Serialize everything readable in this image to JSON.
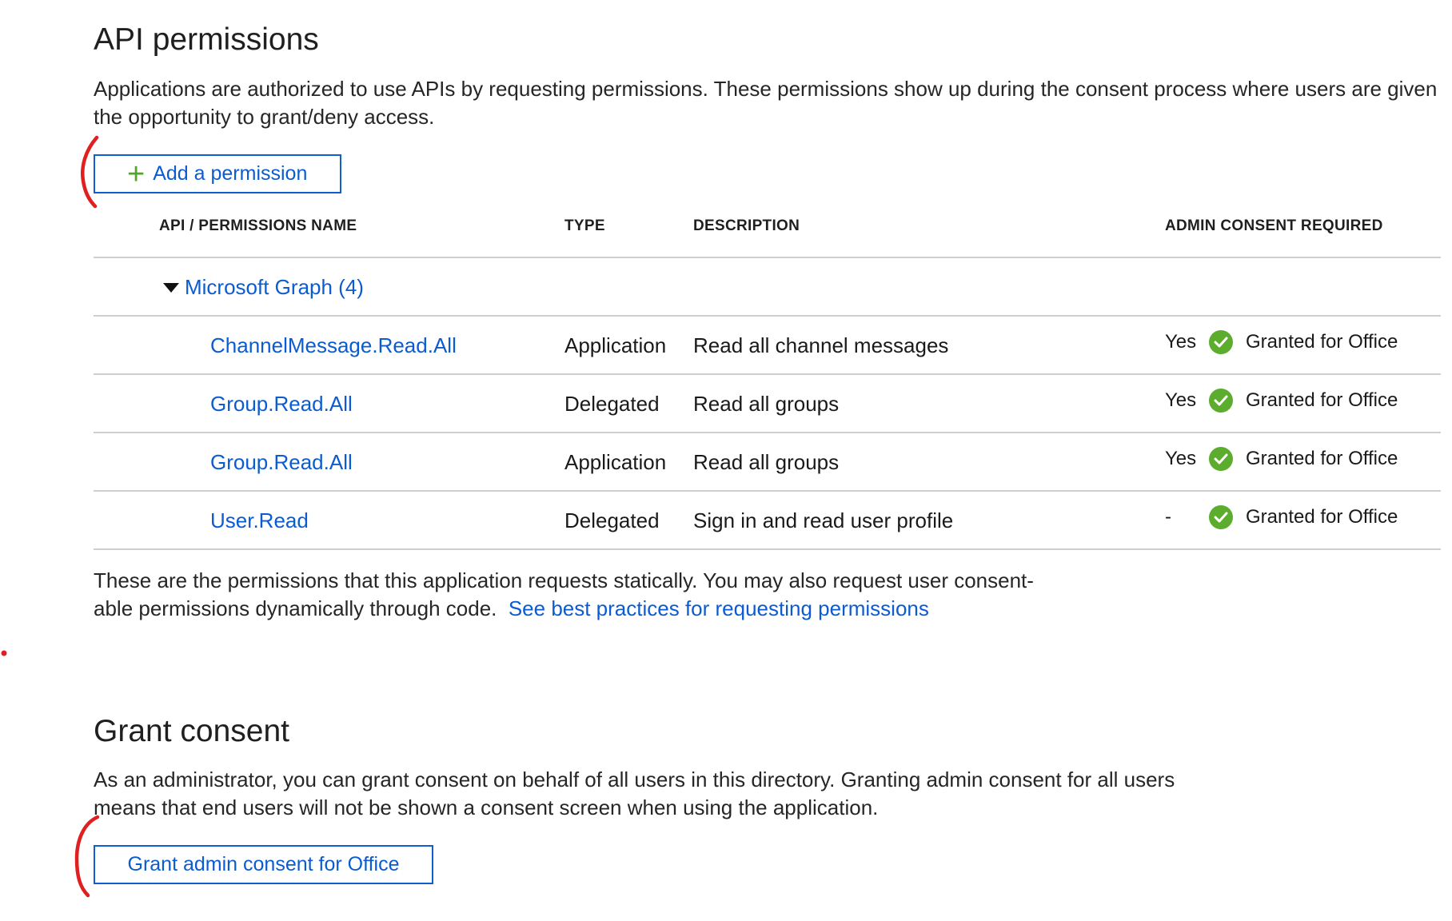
{
  "page": {
    "title": "API permissions",
    "intro_line1": "Applications are authorized to use APIs by requesting permissions. These permissions show up during the consent process where users are given",
    "intro_line2": "the opportunity to grant/deny access."
  },
  "toolbar": {
    "add_permission_label": "Add a permission",
    "add_icon": "plus-icon"
  },
  "table": {
    "headers": {
      "name": "API / PERMISSIONS NAME",
      "type": "TYPE",
      "description": "DESCRIPTION",
      "admin_consent": "ADMIN CONSENT REQUIRED"
    },
    "group": {
      "label": "Microsoft Graph (4)",
      "icon": "caret-down-icon"
    },
    "rows": [
      {
        "name": "ChannelMessage.Read.All",
        "type": "Application",
        "description": "Read all channel messages",
        "admin": "Yes",
        "status": "Granted for Office"
      },
      {
        "name": "Group.Read.All",
        "type": "Delegated",
        "description": "Read all groups",
        "admin": "Yes",
        "status": "Granted for Office"
      },
      {
        "name": "Group.Read.All",
        "type": "Application",
        "description": "Read all groups",
        "admin": "Yes",
        "status": "Granted for Office"
      },
      {
        "name": "User.Read",
        "type": "Delegated",
        "description": "Sign in and read user profile",
        "admin": "-",
        "status": "Granted for Office"
      }
    ]
  },
  "footer": {
    "line1": "These are the permissions that this application requests statically. You may also request user consent-",
    "line2_prefix": "able permissions dynamically through code.",
    "link": "See best practices for requesting permissions"
  },
  "grant": {
    "title": "Grant consent",
    "line1": "As an administrator, you can grant consent on behalf of all users in this directory. Granting admin consent for all users",
    "line2": "means that end users will not be shown a consent screen when using the application.",
    "button_label": "Grant admin consent for Office"
  },
  "colors": {
    "link": "#0b5cd1",
    "accent_border": "#0f5fd0",
    "success": "#5cac2d",
    "plus": "#53a32c",
    "annotation": "#e02020"
  }
}
